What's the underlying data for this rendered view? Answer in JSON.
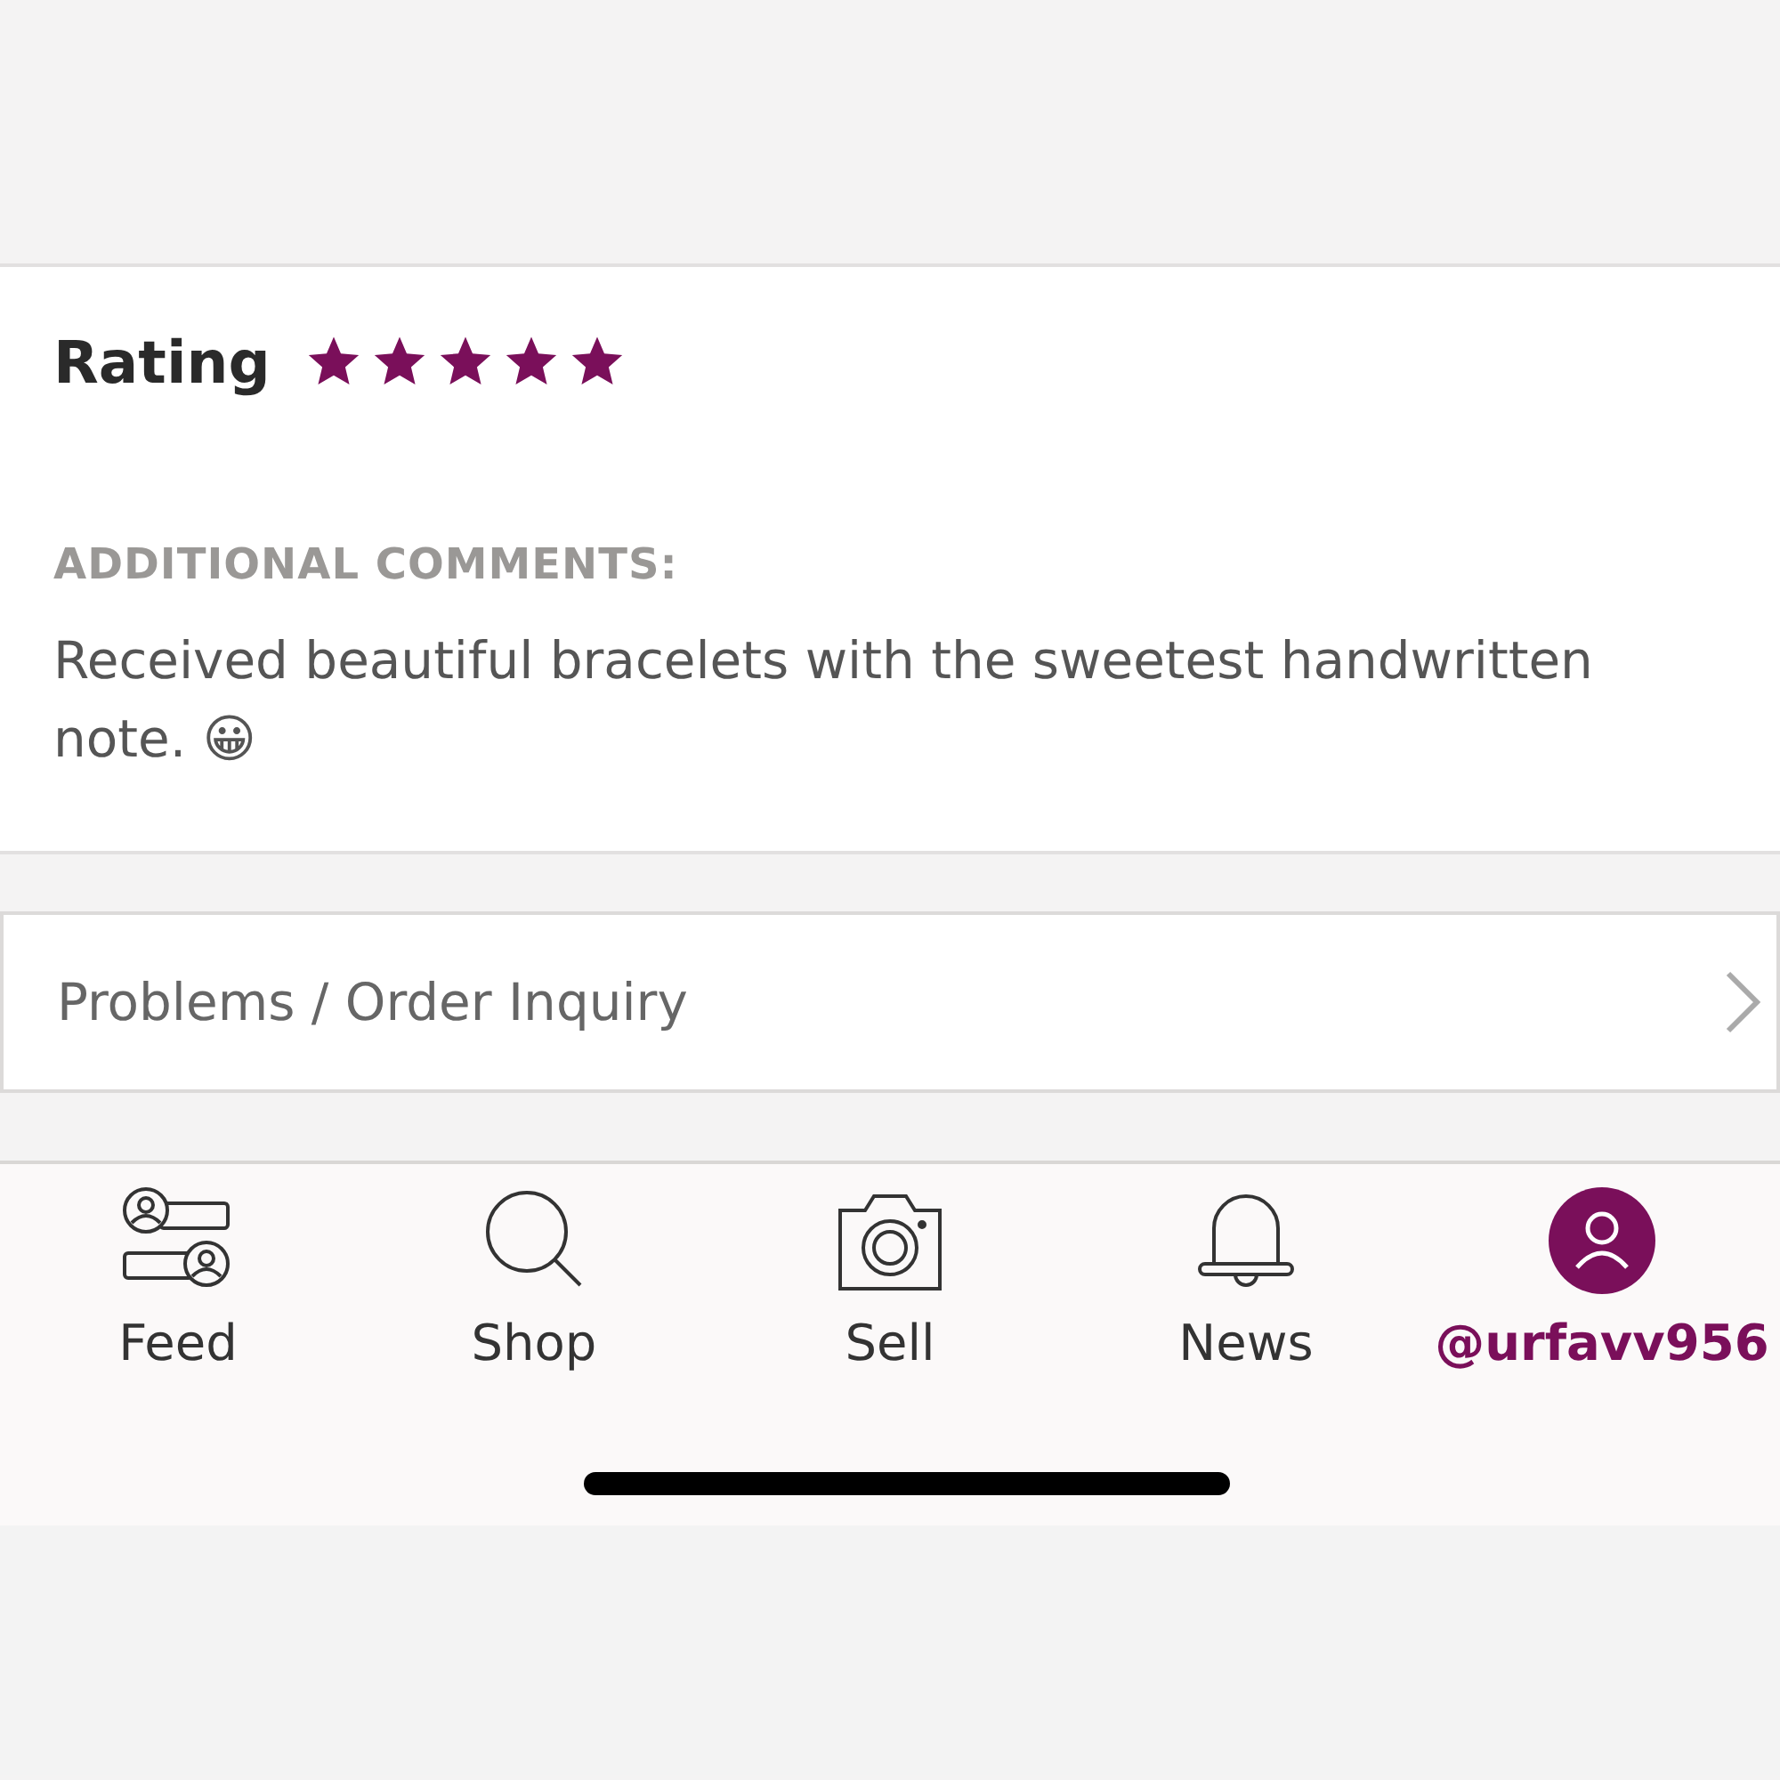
{
  "review": {
    "rating_label": "Rating",
    "stars": 5,
    "comments_label": "ADDITIONAL COMMENTS:",
    "comment": "Received beautiful bracelets with the sweetest handwritten note. 😀"
  },
  "inquiry_row": {
    "label": "Problems / Order Inquiry"
  },
  "tab_bar": [
    {
      "kind": "feed",
      "label": "Feed",
      "selected": false
    },
    {
      "kind": "shop",
      "label": "Shop",
      "selected": false
    },
    {
      "kind": "sell",
      "label": "Sell",
      "selected": false
    },
    {
      "kind": "news",
      "label": "News",
      "selected": false
    },
    {
      "kind": "profile",
      "label": "@urfavv956",
      "selected": true
    }
  ]
}
